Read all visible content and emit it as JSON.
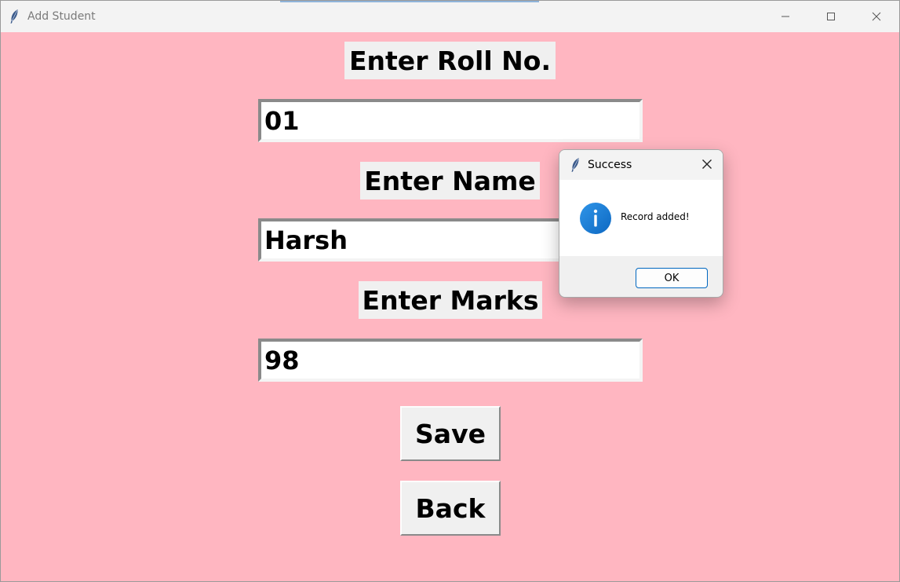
{
  "window": {
    "title": "Add Student"
  },
  "form": {
    "roll": {
      "label": "Enter Roll No.",
      "value": "01"
    },
    "name": {
      "label": "Enter Name",
      "value": "Harsh"
    },
    "marks": {
      "label": "Enter Marks",
      "value": "98"
    },
    "save_label": "Save",
    "back_label": "Back"
  },
  "dialog": {
    "title": "Success",
    "message": "Record added!",
    "ok_label": "OK"
  },
  "colors": {
    "background": "#ffb6c1",
    "info_icon": "#1a7fd6",
    "ok_border": "#0067c0"
  },
  "icons": {
    "app": "feather-icon",
    "minimize": "minimize-icon",
    "maximize": "maximize-icon",
    "close": "close-icon",
    "info": "info-icon"
  }
}
